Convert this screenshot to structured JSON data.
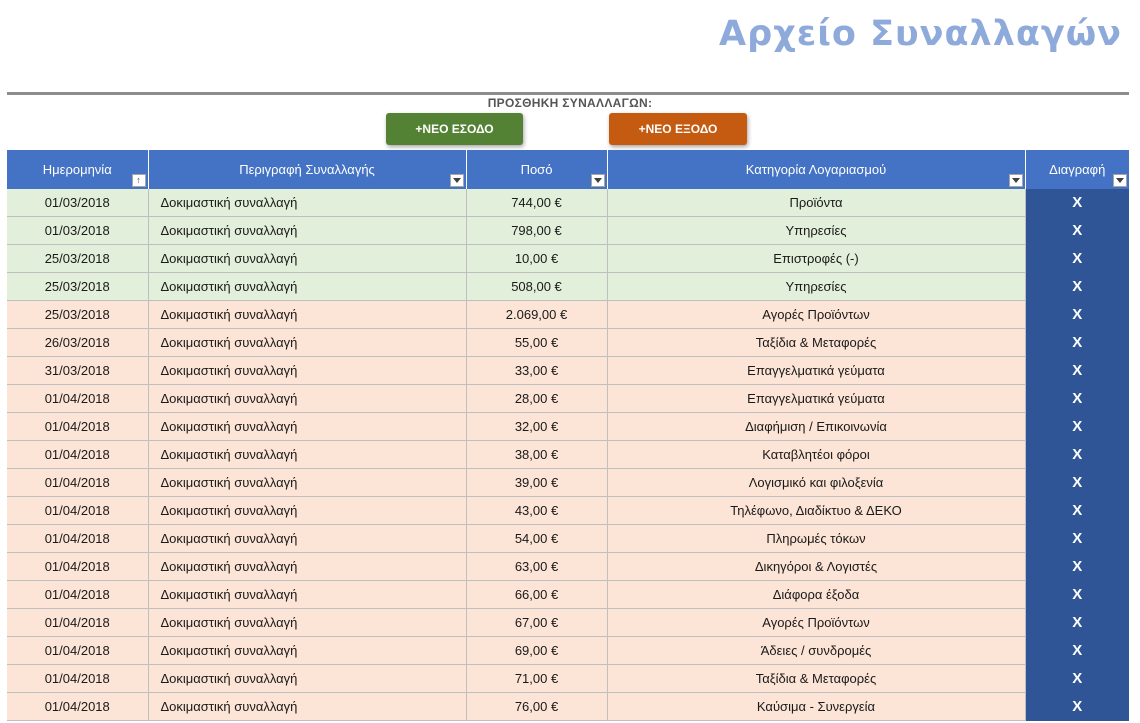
{
  "header": {
    "title": "Αρχείο Συναλλαγών",
    "add_label": "ΠΡΟΣΘΗΚΗ ΣΥΝΑΛΛΑΓΩΝ:",
    "btn_income": "+ΝΕΟ ΕΣΟΔΟ",
    "btn_expense": "+ΝΕΟ ΕΞΟΔΟ"
  },
  "colors": {
    "title": "#8eaadb",
    "header_bg": "#4472c4",
    "income_row": "#e2efda",
    "expense_row": "#fce4d6",
    "delete_col": "#2f5597",
    "btn_income": "#548235",
    "btn_expense": "#c55a11"
  },
  "table": {
    "columns": [
      "Ημερομηνία",
      "Περιγραφή Συναλλαγής",
      "Ποσό",
      "Κατηγορία Λογαριασμού",
      "Διαγραφή"
    ],
    "delete_glyph": "X",
    "rows": [
      {
        "type": "income",
        "date": "01/03/2018",
        "desc": "Δοκιμαστική συναλλαγή",
        "amount": "744,00 €",
        "category": "Προϊόντα"
      },
      {
        "type": "income",
        "date": "01/03/2018",
        "desc": "Δοκιμαστική συναλλαγή",
        "amount": "798,00 €",
        "category": "Υπηρεσίες"
      },
      {
        "type": "income",
        "date": "25/03/2018",
        "desc": "Δοκιμαστική συναλλαγή",
        "amount": "10,00 €",
        "category": "Επιστροφές (-)"
      },
      {
        "type": "income",
        "date": "25/03/2018",
        "desc": "Δοκιμαστική συναλλαγή",
        "amount": "508,00 €",
        "category": "Υπηρεσίες"
      },
      {
        "type": "expense",
        "date": "25/03/2018",
        "desc": "Δοκιμαστική συναλλαγή",
        "amount": "2.069,00 €",
        "category": "Αγορές Προϊόντων"
      },
      {
        "type": "expense",
        "date": "26/03/2018",
        "desc": "Δοκιμαστική συναλλαγή",
        "amount": "55,00 €",
        "category": "Ταξίδια & Μεταφορές"
      },
      {
        "type": "expense",
        "date": "31/03/2018",
        "desc": "Δοκιμαστική συναλλαγή",
        "amount": "33,00 €",
        "category": "Επαγγελματικά γεύματα"
      },
      {
        "type": "expense",
        "date": "01/04/2018",
        "desc": "Δοκιμαστική συναλλαγή",
        "amount": "28,00 €",
        "category": "Επαγγελματικά γεύματα"
      },
      {
        "type": "expense",
        "date": "01/04/2018",
        "desc": "Δοκιμαστική συναλλαγή",
        "amount": "32,00 €",
        "category": "Διαφήμιση / Επικοινωνία"
      },
      {
        "type": "expense",
        "date": "01/04/2018",
        "desc": "Δοκιμαστική συναλλαγή",
        "amount": "38,00 €",
        "category": "Καταβλητέοι φόροι"
      },
      {
        "type": "expense",
        "date": "01/04/2018",
        "desc": "Δοκιμαστική συναλλαγή",
        "amount": "39,00 €",
        "category": "Λογισμικό και φιλοξενία"
      },
      {
        "type": "expense",
        "date": "01/04/2018",
        "desc": "Δοκιμαστική συναλλαγή",
        "amount": "43,00 €",
        "category": "Τηλέφωνο, Διαδίκτυο & ΔΕΚΟ"
      },
      {
        "type": "expense",
        "date": "01/04/2018",
        "desc": "Δοκιμαστική συναλλαγή",
        "amount": "54,00 €",
        "category": "Πληρωμές τόκων"
      },
      {
        "type": "expense",
        "date": "01/04/2018",
        "desc": "Δοκιμαστική συναλλαγή",
        "amount": "63,00 €",
        "category": "Δικηγόροι & Λογιστές"
      },
      {
        "type": "expense",
        "date": "01/04/2018",
        "desc": "Δοκιμαστική συναλλαγή",
        "amount": "66,00 €",
        "category": "Διάφορα έξοδα"
      },
      {
        "type": "expense",
        "date": "01/04/2018",
        "desc": "Δοκιμαστική συναλλαγή",
        "amount": "67,00 €",
        "category": "Αγορές Προϊόντων"
      },
      {
        "type": "expense",
        "date": "01/04/2018",
        "desc": "Δοκιμαστική συναλλαγή",
        "amount": "69,00 €",
        "category": "Άδειες / συνδρομές"
      },
      {
        "type": "expense",
        "date": "01/04/2018",
        "desc": "Δοκιμαστική συναλλαγή",
        "amount": "71,00 €",
        "category": "Ταξίδια & Μεταφορές"
      },
      {
        "type": "expense",
        "date": "01/04/2018",
        "desc": "Δοκιμαστική συναλλαγή",
        "amount": "76,00 €",
        "category": "Καύσιμα - Συνεργεία"
      }
    ]
  }
}
